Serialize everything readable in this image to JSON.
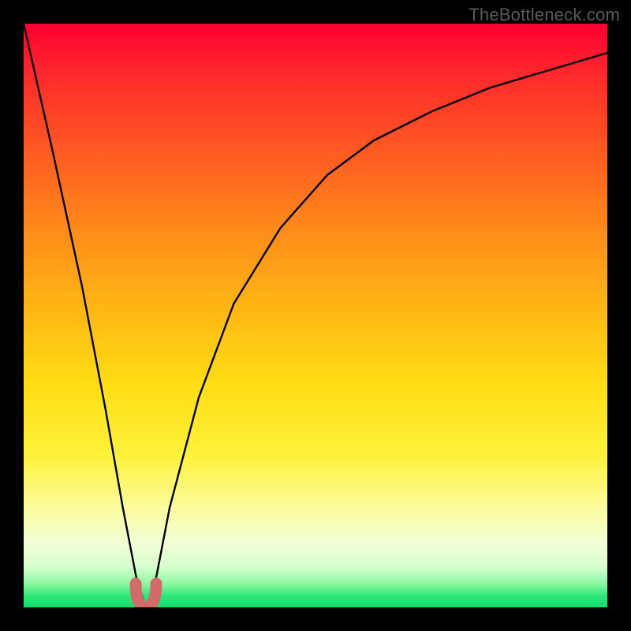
{
  "watermark": "TheBottleneck.com",
  "chart_data": {
    "type": "line",
    "title": "",
    "xlabel": "",
    "ylabel": "",
    "xlim": [
      0,
      1
    ],
    "ylim": [
      0,
      100
    ],
    "grid": false,
    "series": [
      {
        "name": "bottleneck-percentage",
        "x": [
          0.0,
          0.05,
          0.1,
          0.14,
          0.17,
          0.195,
          0.21,
          0.225,
          0.25,
          0.3,
          0.36,
          0.44,
          0.52,
          0.6,
          0.7,
          0.8,
          0.9,
          1.0
        ],
        "values": [
          100,
          78,
          55,
          34,
          17,
          4,
          0,
          4,
          17,
          36,
          52,
          65,
          74,
          80,
          85,
          89,
          92,
          95
        ]
      }
    ],
    "marker": {
      "name": "optimal-point",
      "x": 0.21,
      "value": 0,
      "color": "#d46a6a"
    },
    "background_gradient": {
      "stops": [
        {
          "pos": 0.0,
          "color": "#ff0033"
        },
        {
          "pos": 0.62,
          "color": "#ffde14"
        },
        {
          "pos": 0.93,
          "color": "#d7ffcf"
        },
        {
          "pos": 1.0,
          "color": "#13df6c"
        }
      ]
    }
  }
}
